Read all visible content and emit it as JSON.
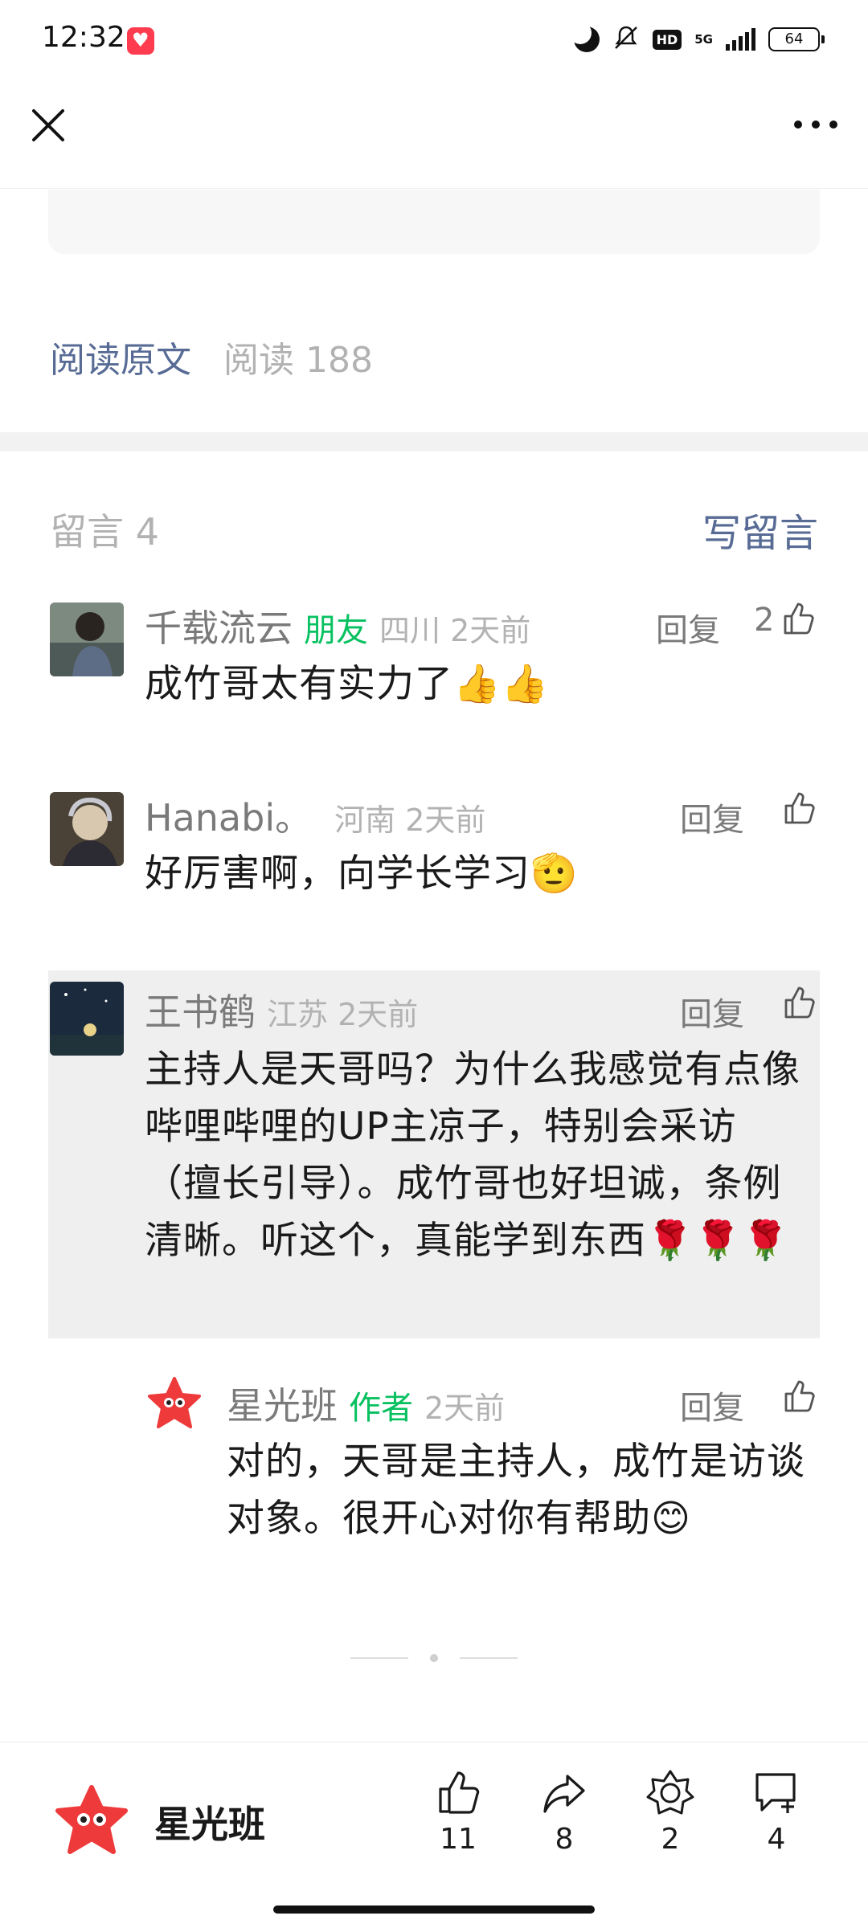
{
  "status_bar": {
    "time": "12:32",
    "network": "5G",
    "hd": "HD",
    "battery": "64"
  },
  "article": {
    "read_original": "阅读原文",
    "read_count": "阅读 188"
  },
  "comments_header": {
    "title": "留言 4",
    "write_label": "写留言"
  },
  "comments": [
    {
      "name": "千载流云",
      "tag": "朋友",
      "location_time": "四川 2天前",
      "reply": "回复",
      "likes": "2",
      "text": "成竹哥太有实力了👍👍"
    },
    {
      "name": "Hanabi。",
      "tag": "",
      "location_time": "河南 2天前",
      "reply": "回复",
      "likes": "",
      "text": "好厉害啊，向学长学习🫡"
    },
    {
      "name": "王书鹤",
      "tag": "",
      "location_time": "江苏 2天前",
      "reply": "回复",
      "likes": "",
      "text": "主持人是天哥吗？为什么我感觉有点像哔哩哔哩的UP主凉子，特别会采访（擅长引导）。成竹哥也好坦诚，条例清晰。听这个，真能学到东西🌹🌹🌹"
    }
  ],
  "author_reply": {
    "name": "星光班",
    "tag": "作者",
    "time": "2天前",
    "reply": "回复",
    "likes": "",
    "text": "对的，天哥是主持人，成竹是访谈对象。很开心对你有帮助😊"
  },
  "bottom_bar": {
    "account_name": "星光班",
    "like_count": "11",
    "share_count": "8",
    "favorite_count": "2",
    "comment_count": "4"
  },
  "colors": {
    "link": "#576b95",
    "tag_green": "#07c160",
    "meta_gray": "#b2b2b2",
    "highlight_bg": "#efefef",
    "star_red": "#ee3a3a"
  },
  "icons": [
    "close-icon",
    "more-icon",
    "thumb-up-icon",
    "share-icon",
    "favorite-icon",
    "comment-icon"
  ]
}
